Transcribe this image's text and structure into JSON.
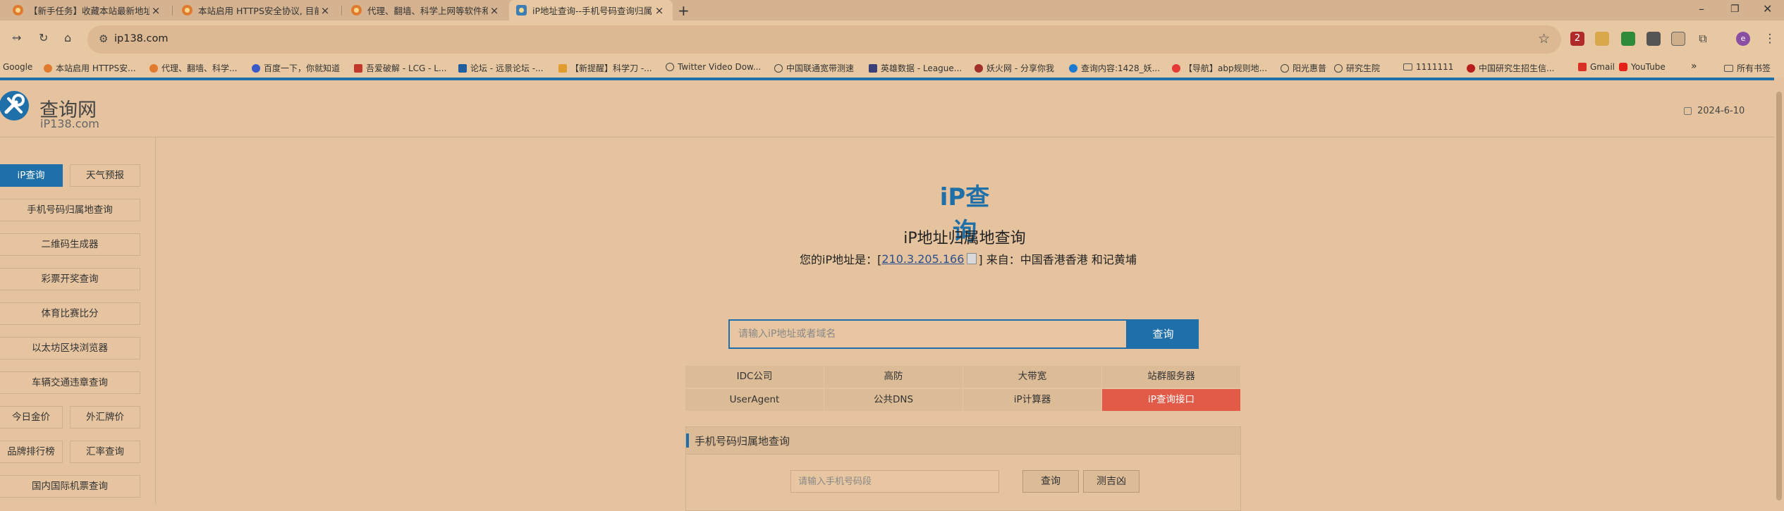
{
  "browser": {
    "tabs": [
      {
        "title": "【新手任务】收藏本站最新地址"
      },
      {
        "title": "本站启用 HTTPS安全协议, 目前"
      },
      {
        "title": "代理、翻墙、科学上网等软件和"
      },
      {
        "title": "iP地址查询--手机号码查询归属"
      }
    ],
    "url": "ip138.com",
    "bookmarks": [
      {
        "label": "Google"
      },
      {
        "label": "本站启用 HTTPS安..."
      },
      {
        "label": "代理、翻墙、科学..."
      },
      {
        "label": "百度一下，你就知道"
      },
      {
        "label": "吾爱破解 - LCG - L..."
      },
      {
        "label": "论坛 - 远景论坛 -..."
      },
      {
        "label": "【新提醒】科学刀 -..."
      },
      {
        "label": "Twitter Video Dow..."
      },
      {
        "label": "中国联通宽带测速"
      },
      {
        "label": "英雄数据 - League..."
      },
      {
        "label": "妖火网 - 分享你我"
      },
      {
        "label": "查询内容:1428_妖..."
      },
      {
        "label": "【导航】abp规则地..."
      },
      {
        "label": "阳光惠普"
      },
      {
        "label": "研究生院"
      },
      {
        "label": "1111111"
      },
      {
        "label": "中国研究生招生信..."
      },
      {
        "label": "Gmail"
      },
      {
        "label": "YouTube"
      }
    ],
    "all_bookmarks": "所有书签",
    "overflow": "»",
    "ext_badge": "2",
    "profile_initial": "e"
  },
  "header": {
    "logo_cn": "查询网",
    "logo_en": "iP138.com",
    "date": "2024-6-10"
  },
  "sidebar": {
    "ip_query": "iP查询",
    "weather": "天气预报",
    "phone": "手机号码归属地查询",
    "qrcode": "二维码生成器",
    "lottery": "彩票开奖查询",
    "sports": "体育比赛比分",
    "ethereum": "以太坊区块浏览器",
    "traffic": "车辆交通违章查询",
    "gold": "今日金价",
    "forex": "外汇牌价",
    "brand": "品牌排行榜",
    "rate": "汇率查询",
    "flights": "国内国际机票查询"
  },
  "main": {
    "title": "iP查询",
    "subtitle": "iP地址归属地查询",
    "ip_prefix": "您的iP地址是：[",
    "ip_value": "210.3.205.166",
    "ip_from": "] 来自：中国香港香港 和记黄埔",
    "search_placeholder": "请输入iP地址或者域名",
    "search_button": "查询",
    "grid": [
      [
        "IDC公司",
        "高防",
        "大带宽",
        "站群服务器"
      ],
      [
        "UserAgent",
        "公共DNS",
        "iP计算器",
        "iP查询接口"
      ]
    ],
    "phone_section": {
      "title": "手机号码归属地查询",
      "placeholder": "请输入手机号码段",
      "query_button": "查询",
      "luck_button": "测吉凶"
    }
  },
  "colors": {
    "accent": "#1f6fa9",
    "highlight": "#e25b48",
    "background": "#e5c39e"
  }
}
